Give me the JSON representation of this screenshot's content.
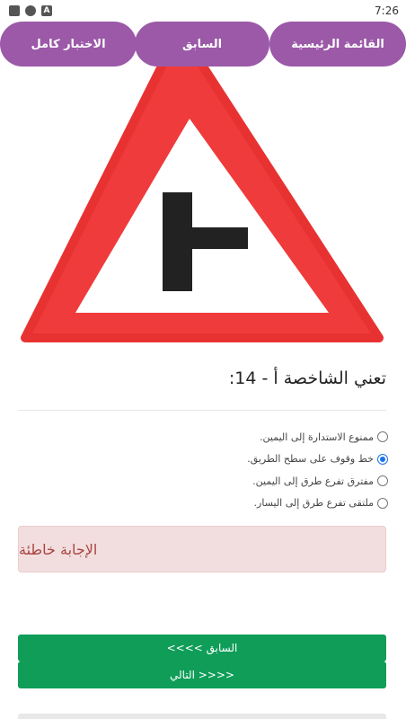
{
  "status_bar": {
    "time": "7:26",
    "icons": [
      "square-icon",
      "circle-icon",
      "a-icon"
    ]
  },
  "nav": {
    "exam_label": "الاختبار كامل",
    "prev_label": "السابق",
    "main_menu_label": "القائمة الرئيسية"
  },
  "sign": {
    "icon": "side-road-right-sign",
    "colors": {
      "border": "#ee3a3a",
      "fill": "#ffffff",
      "symbol": "#222222"
    }
  },
  "question": {
    "text": "تعني الشاخصة أ - 14:"
  },
  "options": [
    {
      "label": "ممنوع الاستدارة إلى اليمين.",
      "selected": false
    },
    {
      "label": "خط وقوف على سطح الطريق.",
      "selected": true
    },
    {
      "label": "مفترق تفرع طرق إلى اليمين.",
      "selected": false
    },
    {
      "label": "ملتقى تفرع طرق إلى اليسار.",
      "selected": false
    }
  ],
  "result": {
    "text": "الإجابة خاطئة",
    "color": "#a94442",
    "background": "#f2dede"
  },
  "buttons": {
    "prev_label": "<<<< السابق",
    "next_label": "التالي >>>>"
  },
  "colors": {
    "nav": "#9b59a8",
    "primary_button": "#0f9d58",
    "radio_accent": "#1a73e8"
  }
}
